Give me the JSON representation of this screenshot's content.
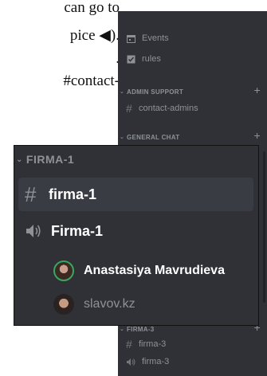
{
  "document": {
    "lines": [
      "can go to",
      "pice ◀).",
      ".",
      "#contact-"
    ]
  },
  "sidebar": {
    "items": [
      {
        "label": "Events",
        "icon": "calendar-icon"
      },
      {
        "label": "rules",
        "icon": "checkbox-icon"
      }
    ],
    "categories": [
      {
        "label": "ADMIN SUPPORT",
        "channels": [
          "contact-admins"
        ]
      },
      {
        "label": "GENERAL CHAT",
        "channels": []
      },
      {
        "label": "FIRMA-3",
        "channels": [
          "firma-3"
        ],
        "voice": [
          "firma-3"
        ]
      }
    ]
  },
  "zoom": {
    "category": "FIRMA-1",
    "text_channel": "firma-1",
    "voice_channel": "Firma-1",
    "users": [
      "Anastasiya Mavrudieva",
      "slavov.kz"
    ]
  },
  "colors": {
    "background": "#2f3136",
    "active_row": "#393c43",
    "muted_text": "#8e9297",
    "speaking_ring": "#3ba55d"
  }
}
